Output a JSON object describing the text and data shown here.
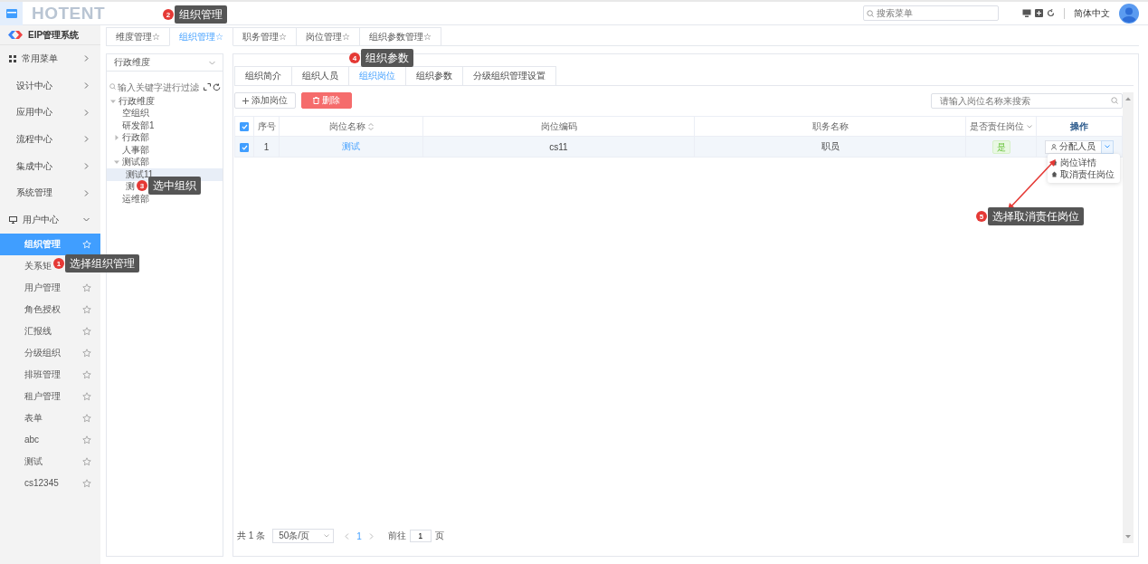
{
  "header": {
    "logo": "HOTENT",
    "search": {
      "placeholder": "搜索菜单"
    },
    "language": "简体中文"
  },
  "sidebar": {
    "title": "EIP管理系统",
    "items": [
      {
        "label": "常用菜单",
        "kind": "grid",
        "expanded": false
      },
      {
        "label": "设计中心",
        "kind": "plain",
        "expanded": false
      },
      {
        "label": "应用中心",
        "kind": "plain",
        "expanded": false
      },
      {
        "label": "流程中心",
        "kind": "plain",
        "expanded": false
      },
      {
        "label": "集成中心",
        "kind": "plain",
        "expanded": false
      },
      {
        "label": "系统管理",
        "kind": "plain",
        "expanded": false
      },
      {
        "label": "用户中心",
        "kind": "monitor",
        "expanded": true,
        "children": [
          {
            "label": "组织管理",
            "selected": true
          },
          {
            "label": "关系矩",
            "selected": false
          },
          {
            "label": "用户管理",
            "selected": false
          },
          {
            "label": "角色授权",
            "selected": false
          },
          {
            "label": "汇报线",
            "selected": false
          },
          {
            "label": "分级组织",
            "selected": false
          },
          {
            "label": "排班管理",
            "selected": false
          },
          {
            "label": "租户管理",
            "selected": false
          },
          {
            "label": "表单",
            "selected": false
          },
          {
            "label": "abc",
            "selected": false
          },
          {
            "label": "测试",
            "selected": false
          },
          {
            "label": "cs12345",
            "selected": false
          }
        ]
      }
    ]
  },
  "tabs": [
    {
      "label": "维度管理☆",
      "selected": false
    },
    {
      "label": "组织管理☆",
      "selected": true
    },
    {
      "label": "职务管理☆",
      "selected": false
    },
    {
      "label": "岗位管理☆",
      "selected": false
    },
    {
      "label": "组织参数管理☆",
      "selected": false
    }
  ],
  "tree_panel": {
    "dimension": "行政维度",
    "filter_placeholder": "输入关键字进行过滤",
    "tree": [
      {
        "label": "行政维度",
        "expanded": true,
        "selected": false,
        "children": [
          {
            "label": "空组织",
            "selected": false
          },
          {
            "label": "研发部1",
            "selected": false
          },
          {
            "label": "行政部",
            "expanded": false,
            "selected": false
          },
          {
            "label": "人事部",
            "selected": false
          },
          {
            "label": "测试部",
            "expanded": true,
            "selected": false,
            "children": [
              {
                "label": "测试11",
                "selected": true
              },
              {
                "label": "测",
                "selected": false
              }
            ]
          },
          {
            "label": "运维部",
            "selected": false
          }
        ]
      }
    ]
  },
  "content": {
    "tabs": [
      {
        "label": "组织简介",
        "selected": false
      },
      {
        "label": "组织人员",
        "selected": false
      },
      {
        "label": "组织岗位",
        "selected": true
      },
      {
        "label": "组织参数",
        "selected": false
      },
      {
        "label": "分级组织管理设置",
        "selected": false
      }
    ],
    "add_button": "添加岗位",
    "delete_button": "删除",
    "search": {
      "placeholder": "请输入岗位名称来搜索"
    },
    "table": {
      "all_checked": true,
      "columns": [
        {
          "label": "序号",
          "kind": "plain"
        },
        {
          "label": "岗位名称",
          "kind": "sort"
        },
        {
          "label": "岗位编码",
          "kind": "plain"
        },
        {
          "label": "职务名称",
          "kind": "plain"
        },
        {
          "label": "是否责任岗位",
          "kind": "filter"
        },
        {
          "label": "操作",
          "kind": "action"
        }
      ],
      "rows": [
        {
          "checked": true,
          "index": "1",
          "name": "测试",
          "code": "cs11",
          "job": "职员",
          "responsible": "是",
          "action": "分配人员"
        }
      ]
    },
    "dropdown": [
      {
        "label": "岗位详情"
      },
      {
        "label": "取消责任岗位"
      }
    ],
    "pagination": {
      "total": "共 1 条",
      "page_size": "50条/页",
      "current": "1",
      "goto_label": "前往",
      "goto_value": "1",
      "goto_suffix": "页"
    }
  },
  "annotations": [
    {
      "number": "1",
      "text": "选择组织管理"
    },
    {
      "number": "2",
      "text": "组织管理"
    },
    {
      "number": "3",
      "text": "选中组织"
    },
    {
      "number": "4",
      "text": "组织参数"
    },
    {
      "number": "5",
      "text": "选择取消责任岗位"
    }
  ]
}
